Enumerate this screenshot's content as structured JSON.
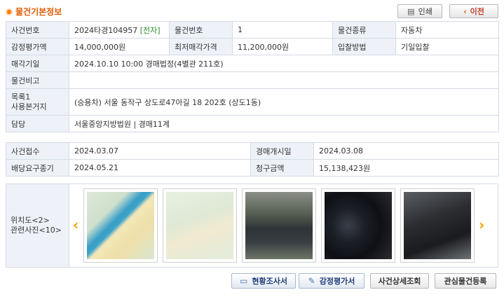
{
  "header": {
    "title": "물건기본정보",
    "print_label": "인쇄",
    "prev_label": "이전"
  },
  "info": {
    "case_no_label": "사건번호",
    "case_no_value": "2024타경104957",
    "case_no_tag": "[전자]",
    "item_no_label": "물건번호",
    "item_no_value": "1",
    "item_type_label": "물건종류",
    "item_type_value": "자동차",
    "appraisal_label": "감정평가액",
    "appraisal_value": "14,000,000원",
    "min_price_label": "최저매각가격",
    "min_price_value": "11,200,000원",
    "bid_method_label": "입찰방법",
    "bid_method_value": "기일입찰",
    "sale_date_label": "매각기일",
    "sale_date_value": "2024.10.10 10:00 경매법정(4별관 211호)",
    "remarks_label": "물건비고",
    "remarks_value": "",
    "list_label_1": "목록1",
    "list_label_2": "사용본거지",
    "list_value": "(승용차) 서울 동작구 상도로47아길 18 202호 (상도1동)",
    "charge_label": "담당",
    "charge_value": "서울중앙지방법원 | 경매11계"
  },
  "case": {
    "receipt_label": "사건접수",
    "receipt_value": "2024.03.07",
    "start_label": "경매개시일",
    "start_value": "2024.03.08",
    "deadline_label": "배당요구종기",
    "deadline_value": "2024.05.21",
    "claim_label": "청구금액",
    "claim_value": "15,138,423원"
  },
  "photos": {
    "label_1": "위치도<2>",
    "label_2": "관련사진<10>"
  },
  "footer": {
    "survey_label": "현황조사서",
    "appraisal_doc_label": "감정평가서",
    "case_detail_label": "사건상세조회",
    "watch_label": "관심물건등록"
  },
  "icons": {
    "title": "bullet-icon",
    "print": "printer-icon",
    "prev": "chevron-left-icon",
    "left_arrow": "chevron-left-icon",
    "right_arrow": "chevron-right-icon"
  }
}
